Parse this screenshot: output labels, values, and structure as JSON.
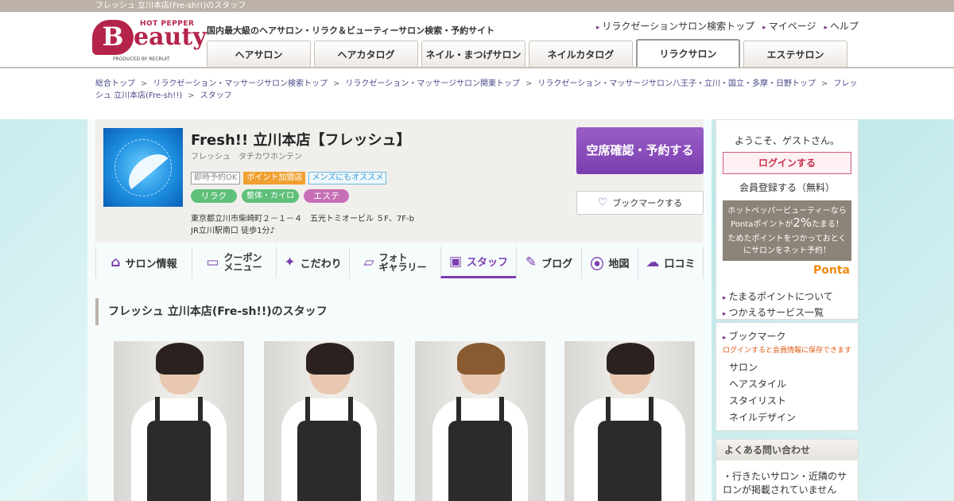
{
  "page_title": "フレッシュ 立川本店(Fre-sh!!)のスタッフ",
  "header": {
    "logo_top": "HOT PEPPER",
    "logo_b": "B",
    "logo_rest": "eauty",
    "logo_produced": "PRODUCED BY RECRUIT",
    "tagline": "国内最大級のヘアサロン・リラク＆ビューティーサロン検索・予約サイト",
    "links": [
      "リラクゼーションサロン検索トップ",
      "マイページ",
      "ヘルプ"
    ],
    "nav": [
      "ヘアサロン",
      "ヘアカタログ",
      "ネイル・まつげサロン",
      "ネイルカタログ",
      "リラクサロン",
      "エステサロン"
    ]
  },
  "breadcrumb": {
    "items": [
      "総合トップ",
      "リラクゼーション・マッサージサロン検索トップ",
      "リラクゼーション・マッサージサロン関東トップ",
      "リラクゼーション・マッサージサロン八王子・立川・国立・多摩・日野トップ",
      "フレッシュ 立川本店(Fre-sh!!)",
      "スタッフ"
    ],
    "separator": ">"
  },
  "salon": {
    "name": "Fresh!! 立川本店【フレッシュ】",
    "kana": "フレッシュ　タチカワホンテン",
    "tags": [
      "即時予約OK",
      "ポイント加盟店",
      "メンズにもオススメ"
    ],
    "categories": [
      "リラク",
      "整体・カイロ",
      "エステ"
    ],
    "address": "東京都立川市柴崎町２－１－４　五光トミオービル ５F、7F-b",
    "access": "JR立川駅南口 徒歩1分♪",
    "reserve_label": "空席確認・予約する",
    "bookmark_label": "ブックマークする"
  },
  "tabs": [
    {
      "label": "サロン情報",
      "icon": "home-icon"
    },
    {
      "label": "クーポン",
      "label2": "メニュー",
      "icon": "coupon-icon"
    },
    {
      "label": "こだわり",
      "icon": "sparkle-icon"
    },
    {
      "label": "フォト",
      "label2": "ギャラリー",
      "icon": "photo-icon"
    },
    {
      "label": "スタッフ",
      "icon": "staff-icon"
    },
    {
      "label": "ブログ",
      "icon": "pen-icon"
    },
    {
      "label": "地図",
      "icon": "map-pin-icon"
    },
    {
      "label": "口コミ",
      "icon": "chat-icon"
    }
  ],
  "section_title": "フレッシュ 立川本店(Fre-sh!!)のスタッフ",
  "sidebar": {
    "welcome": "ようこそ、ゲストさん。",
    "login": "ログインする",
    "register": "会員登録する（無料）",
    "ponta_line1": "ホットペッパービューティーなら",
    "ponta_line2a": "Pontaポイントが",
    "ponta_line2b": "2%",
    "ponta_line2c": "たまる！",
    "ponta_line3": "ためたポイントをつかっておとく",
    "ponta_line4": "にサロンをネット予約！",
    "ponta_logo": "Ponta",
    "ponta_links": [
      "たまるポイントについて",
      "つかえるサービス一覧"
    ],
    "bookmark_title": "ブックマーク",
    "bookmark_note": "ログインすると会員情報に保存できます",
    "bookmark_items": [
      "サロン",
      "ヘアスタイル",
      "スタイリスト",
      "ネイルデザイン"
    ],
    "faq_title": "よくある問い合わせ",
    "faq_item": "行きたいサロン・近隣のサロンが掲載されていません"
  }
}
